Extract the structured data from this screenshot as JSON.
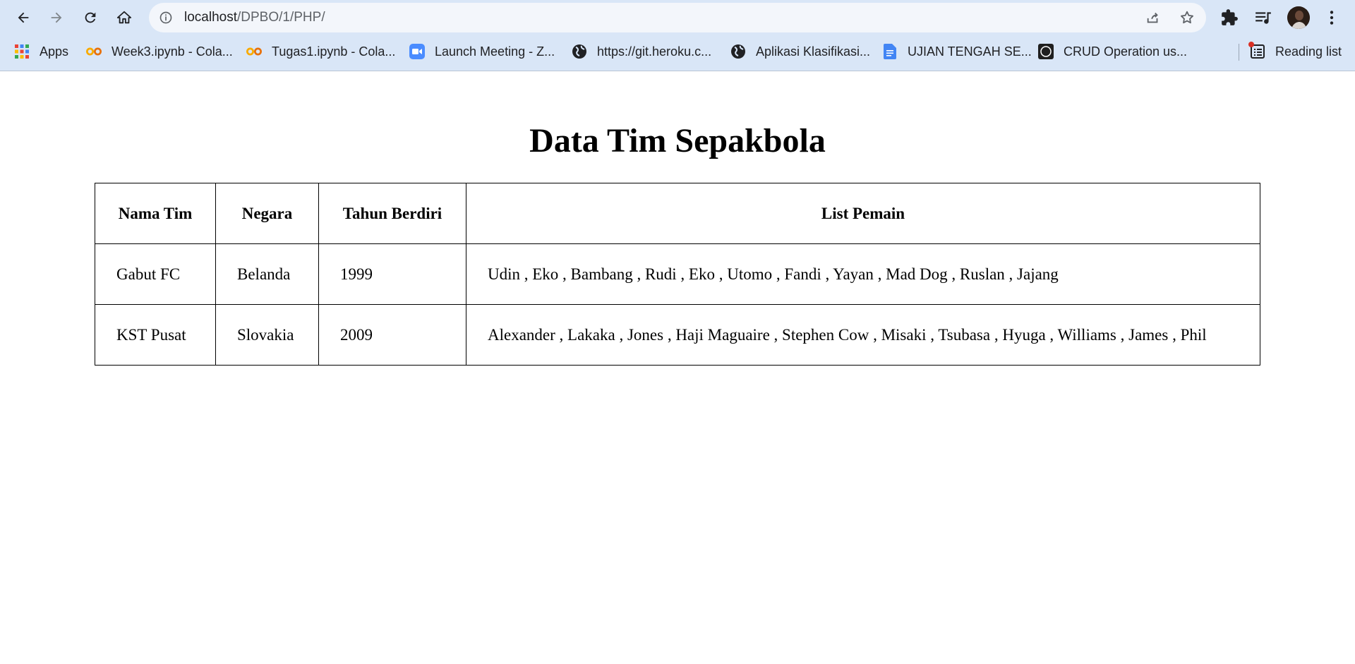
{
  "browser": {
    "url_host": "localhost",
    "url_path": "/DPBO/1/PHP/"
  },
  "bookmarks": [
    {
      "label": "Apps",
      "icon": "apps-grid-icon"
    },
    {
      "label": "Week3.ipynb - Cola...",
      "icon": "colab-icon"
    },
    {
      "label": "Tugas1.ipynb - Cola...",
      "icon": "colab-icon"
    },
    {
      "label": "Launch Meeting - Z...",
      "icon": "zoom-icon"
    },
    {
      "label": "https://git.heroku.c...",
      "icon": "globe-icon"
    },
    {
      "label": "Aplikasi Klasifikasi...",
      "icon": "globe-icon"
    },
    {
      "label": "UJIAN TENGAH SE...",
      "icon": "docs-icon"
    },
    {
      "label": "CRUD Operation us...",
      "icon": "site-icon"
    }
  ],
  "reading_list_label": "Reading list",
  "page": {
    "title": "Data Tim Sepakbola",
    "headers": [
      "Nama Tim",
      "Negara",
      "Tahun Berdiri",
      "List Pemain"
    ],
    "rows": [
      [
        "Gabut FC",
        "Belanda",
        "1999",
        "Udin , Eko , Bambang , Rudi , Eko , Utomo , Fandi , Yayan , Mad Dog , Ruslan , Jajang"
      ],
      [
        "KST Pusat",
        "Slovakia",
        "2009",
        "Alexander , Lakaka , Jones , Haji Maguaire , Stephen Cow , Misaki , Tsubasa , Hyuga , Williams , James , Phil"
      ]
    ]
  }
}
